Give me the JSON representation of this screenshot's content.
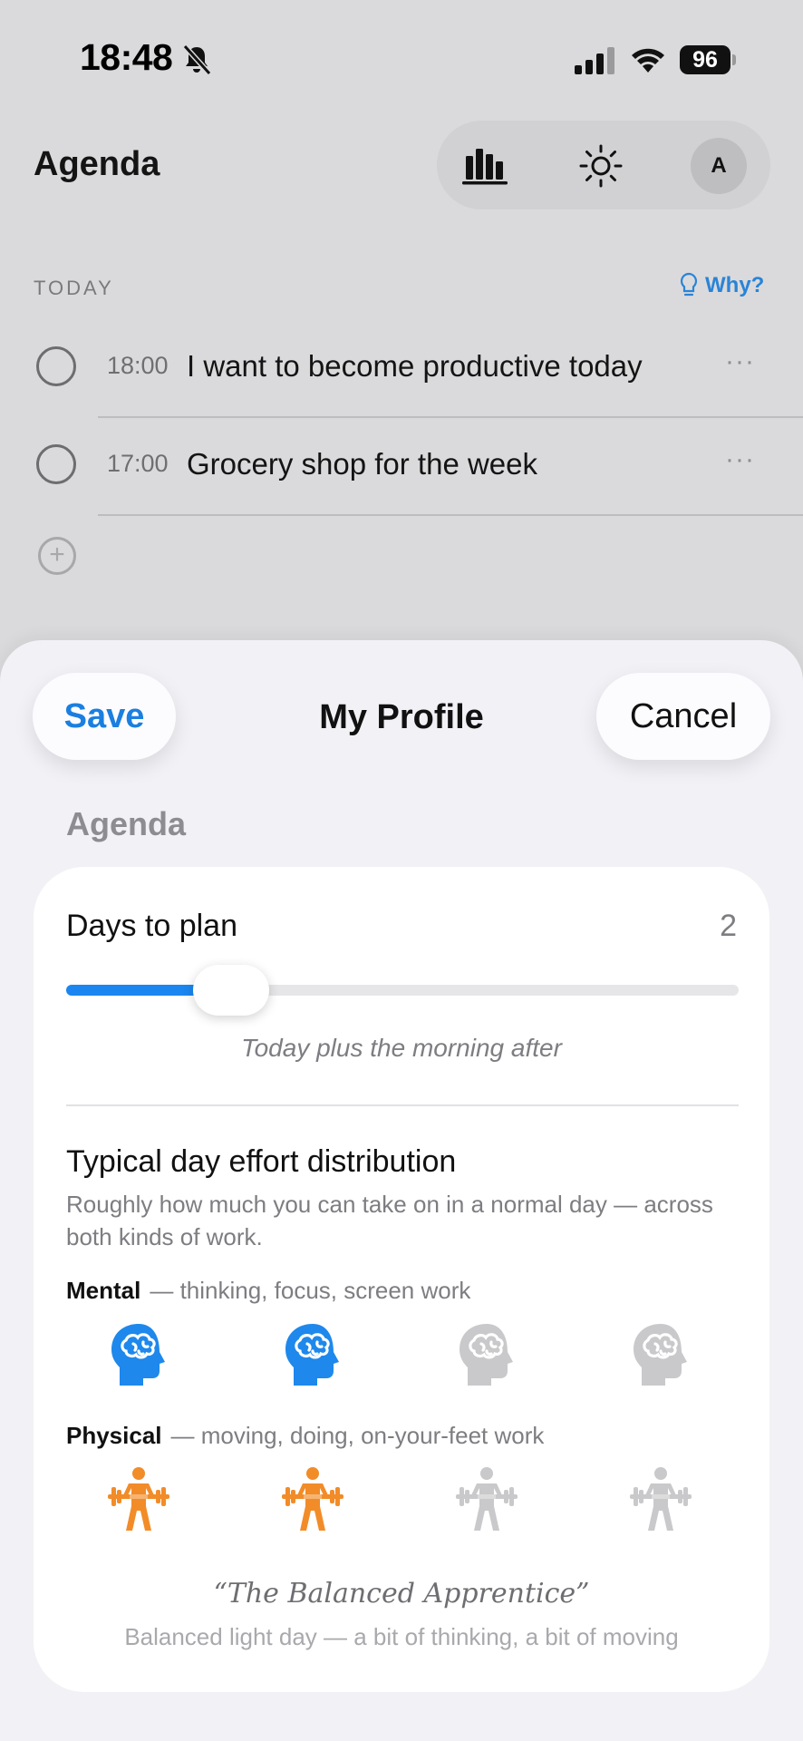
{
  "status_bar": {
    "time": "18:48",
    "battery": "96"
  },
  "header": {
    "title": "Agenda",
    "avatar_initial": "A"
  },
  "today": {
    "section_label": "TODAY",
    "why_label": "Why?",
    "tasks": [
      {
        "time": "18:00",
        "title": "I want to become productive today"
      },
      {
        "time": "17:00",
        "title": "Grocery shop for the week"
      }
    ],
    "task_more": "···"
  },
  "sheet": {
    "save_label": "Save",
    "title": "My Profile",
    "cancel_label": "Cancel",
    "group_label": "Agenda",
    "days_to_plan": {
      "label": "Days to plan",
      "value": "2",
      "slider_fraction": 0.2,
      "caption": "Today plus the morning after"
    },
    "effort": {
      "title": "Typical day effort distribution",
      "description": "Roughly how much you can take on in a normal day — across both kinds of work.",
      "mental": {
        "label": "Mental",
        "hint": "— thinking, focus, screen work",
        "level": 2,
        "max": 4,
        "active_color": "#1e88ec",
        "icon": "brain-head-icon"
      },
      "physical": {
        "label": "Physical",
        "hint": "— moving, doing, on-your-feet work",
        "level": 2,
        "max": 4,
        "active_color": "#f28c28",
        "icon": "weightlifter-icon"
      },
      "inactive_color": "#c9c9cb",
      "profile_name": "“The Balanced Apprentice”",
      "profile_description": "Balanced light day — a bit of thinking, a bit of moving"
    }
  }
}
